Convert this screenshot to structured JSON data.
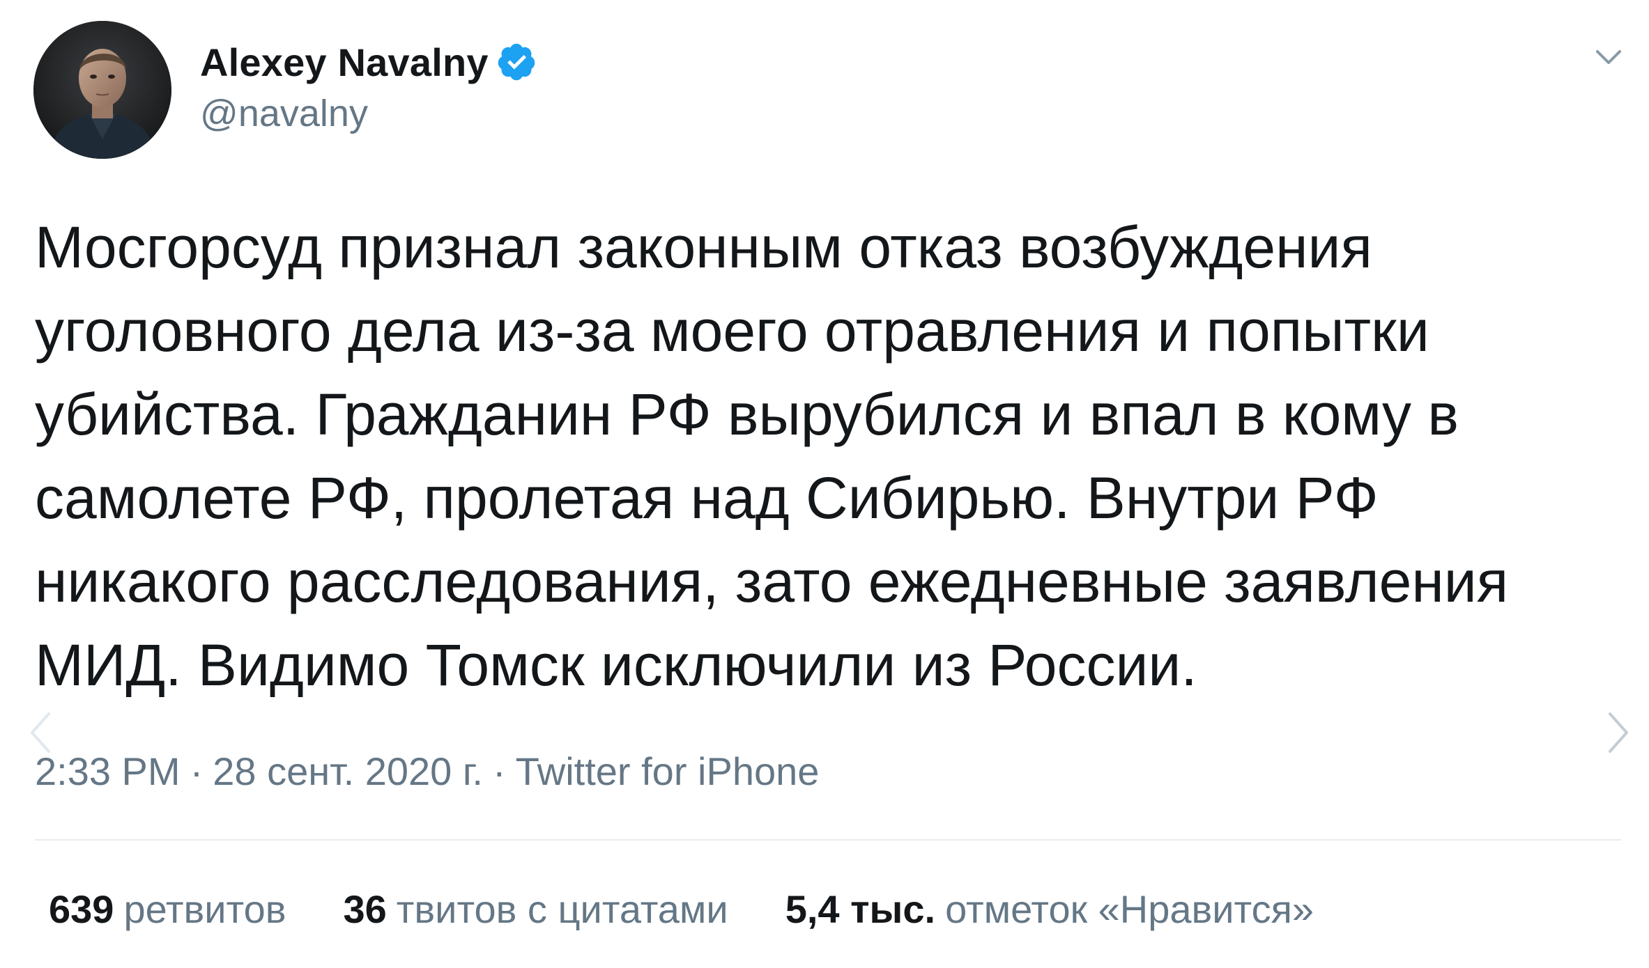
{
  "author": {
    "display_name": "Alexey Navalny",
    "handle": "@navalny",
    "verified": true,
    "verified_icon": "verified-badge-icon",
    "avatar_icon": "profile-photo"
  },
  "menu_icon": "chevron-down-icon",
  "tweet": {
    "text": "Мосгорсуд признал законным отказ возбуждения\nуголовного дела из-за моего отравления и попытки\nубийства. Гражданин РФ вырубился и впал в кому в\nсамолете РФ, пролетая над Сибирью. Внутри РФ\nникакого расследования, зато ежедневные заявления\nМИД. Видимо Томск исключили из России."
  },
  "meta": {
    "time": "2:33 PM",
    "separator": "·",
    "date": "28 сент. 2020 г.",
    "source": "Twitter for iPhone"
  },
  "stats": {
    "retweets": {
      "count": "639",
      "label": "ретвитов"
    },
    "quotes": {
      "count": "36",
      "label": "твитов с цитатами"
    },
    "likes": {
      "count": "5,4 тыс.",
      "label": "отметок «Нравится»"
    }
  },
  "navigation": {
    "prev_icon": "chevron-left-icon",
    "next_icon": "chevron-right-icon"
  },
  "colors": {
    "text_primary": "#14171a",
    "text_secondary": "#657786",
    "verified_blue": "#1da1f2",
    "divider": "#e6ecf0"
  }
}
